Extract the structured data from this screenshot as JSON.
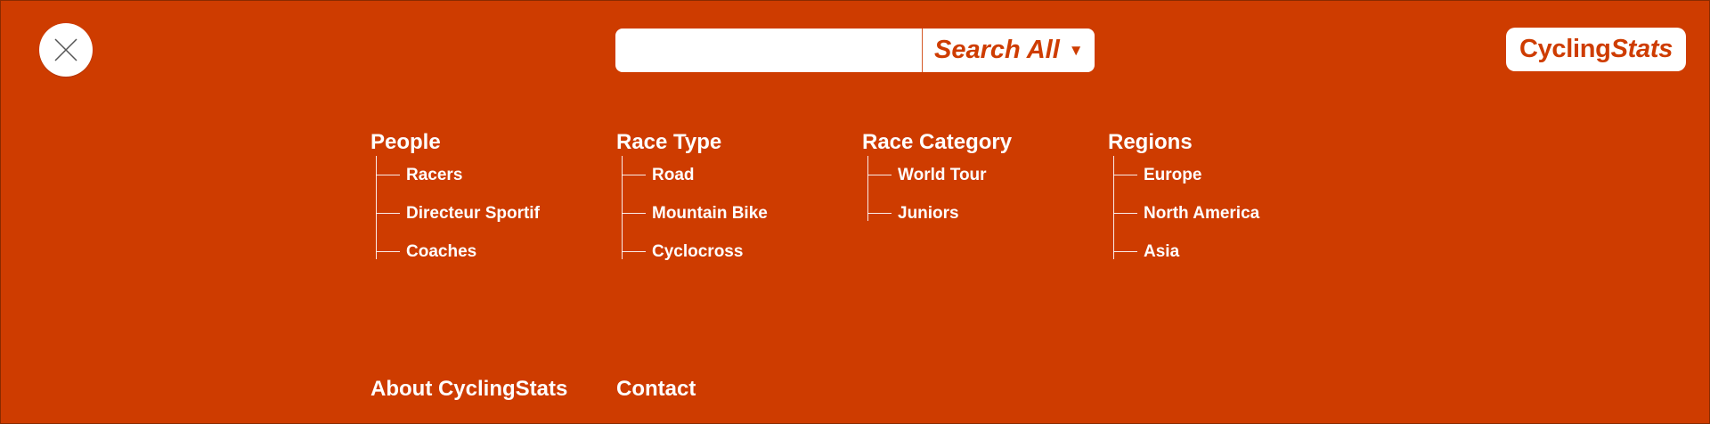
{
  "close": {
    "icon": "close-icon"
  },
  "search": {
    "value": "",
    "placeholder": "",
    "scope_label": "Search All",
    "caret": "▼"
  },
  "logo": {
    "part_a": "Cycling",
    "part_b": "Stats"
  },
  "columns": [
    {
      "title": "People",
      "items": [
        "Racers",
        "Directeur Sportif",
        "Coaches"
      ]
    },
    {
      "title": "Race Type",
      "items": [
        "Road",
        "Mountain Bike",
        "Cyclocross"
      ]
    },
    {
      "title": "Race Category",
      "items": [
        "World Tour",
        "Juniors"
      ]
    },
    {
      "title": "Regions",
      "items": [
        "Europe",
        "North America",
        "Asia"
      ]
    }
  ],
  "footer": {
    "about": "About CyclingStats",
    "contact": "Contact"
  },
  "colors": {
    "background": "#ce3c00",
    "text": "#ffffff",
    "accent": "#ce3c00"
  }
}
